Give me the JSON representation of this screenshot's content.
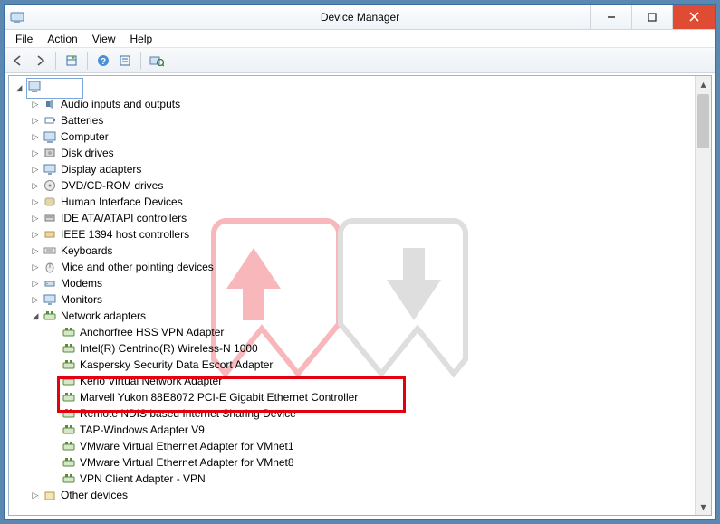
{
  "window": {
    "title": "Device Manager"
  },
  "menu": {
    "file": "File",
    "action": "Action",
    "view": "View",
    "help": "Help"
  },
  "categories": [
    {
      "label": "Audio inputs and outputs",
      "icon": "speaker"
    },
    {
      "label": "Batteries",
      "icon": "battery"
    },
    {
      "label": "Computer",
      "icon": "pc"
    },
    {
      "label": "Disk drives",
      "icon": "disk"
    },
    {
      "label": "Display adapters",
      "icon": "display"
    },
    {
      "label": "DVD/CD-ROM drives",
      "icon": "disc"
    },
    {
      "label": "Human Interface Devices",
      "icon": "hid"
    },
    {
      "label": "IDE ATA/ATAPI controllers",
      "icon": "ide"
    },
    {
      "label": "IEEE 1394 host controllers",
      "icon": "firewire"
    },
    {
      "label": "Keyboards",
      "icon": "keyboard"
    },
    {
      "label": "Mice and other pointing devices",
      "icon": "mouse"
    },
    {
      "label": "Modems",
      "icon": "modem"
    },
    {
      "label": "Monitors",
      "icon": "monitor"
    }
  ],
  "netcat": {
    "label": "Network adapters"
  },
  "adapters": [
    "Anchorfree HSS VPN Adapter",
    "Intel(R) Centrino(R) Wireless-N 1000",
    "Kaspersky Security Data Escort Adapter",
    "Kerio Virtual Network Adapter",
    "Marvell Yukon 88E8072 PCI-E Gigabit Ethernet Controller",
    "Remote NDIS based Internet Sharing Device",
    "TAP-Windows Adapter V9",
    "VMware Virtual Ethernet Adapter for VMnet1",
    "VMware Virtual Ethernet Adapter for VMnet8",
    "VPN Client Adapter - VPN"
  ],
  "othercat": {
    "label": "Other devices"
  }
}
